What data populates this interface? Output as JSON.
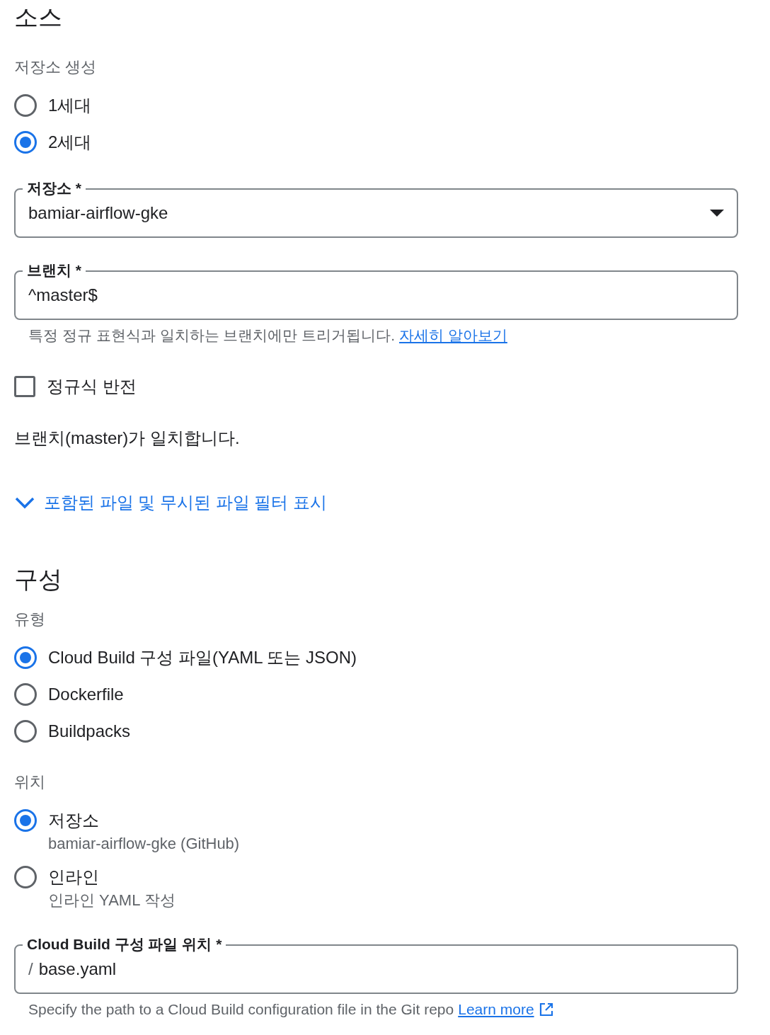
{
  "source": {
    "title": "소스",
    "repo_generation": {
      "label": "저장소 생성",
      "options": [
        {
          "label": "1세대",
          "selected": false
        },
        {
          "label": "2세대",
          "selected": true
        }
      ]
    },
    "repository_field": {
      "label": "저장소 *",
      "value": "bamiar-airflow-gke"
    },
    "branch_field": {
      "label": "브랜치 *",
      "value": "^master$",
      "helper": "특정 정규 표현식과 일치하는 브랜치에만 트리거됩니다.",
      "helper_link": "자세히 알아보기"
    },
    "invert_regex": {
      "label": "정규식 반전",
      "checked": false
    },
    "match_message": "브랜치(master)가 일치합니다.",
    "filter_toggle": {
      "label": "포함된 파일 및 무시된 파일 필터 표시",
      "expanded": false
    }
  },
  "config": {
    "title": "구성",
    "type": {
      "label": "유형",
      "options": [
        {
          "label": "Cloud Build 구성 파일(YAML 또는 JSON)",
          "selected": true
        },
        {
          "label": "Dockerfile",
          "selected": false
        },
        {
          "label": "Buildpacks",
          "selected": false
        }
      ]
    },
    "location": {
      "label": "위치",
      "options": [
        {
          "label": "저장소",
          "sublabel": "bamiar-airflow-gke (GitHub)",
          "selected": true
        },
        {
          "label": "인라인",
          "sublabel": "인라인 YAML 작성",
          "selected": false
        }
      ]
    },
    "config_file_field": {
      "label": "Cloud Build 구성 파일 위치 *",
      "prefix": "/",
      "value": "base.yaml",
      "helper": "Specify the path to a Cloud Build configuration file in the Git repo",
      "helper_link": "Learn more"
    }
  }
}
